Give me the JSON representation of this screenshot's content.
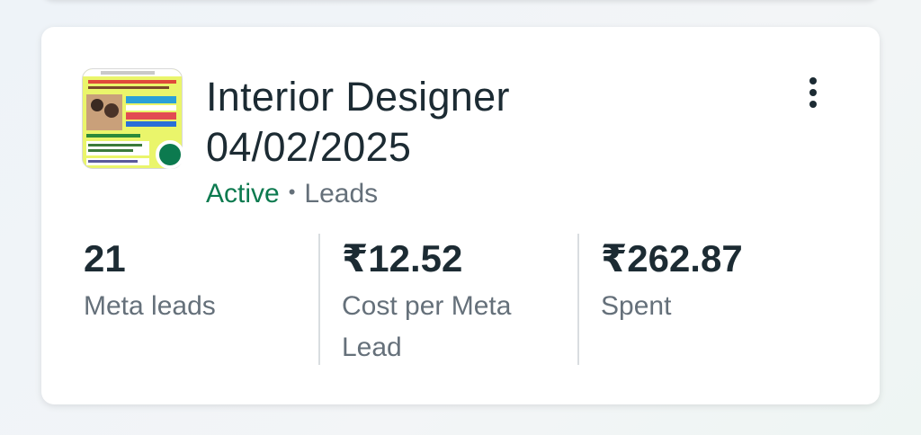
{
  "campaign": {
    "title_line1": "Interior Designer",
    "title_line2": "04/02/2025",
    "status": "Active",
    "separator": "•",
    "objective": "Leads",
    "status_color": "#0c7a4f"
  },
  "metrics": [
    {
      "value": "21",
      "label": "Meta leads"
    },
    {
      "value": "₹12.52",
      "label": "Cost per Meta Lead"
    },
    {
      "value": "₹262.87",
      "label": "Spent"
    }
  ],
  "icons": {
    "more": "more-vertical-icon",
    "status_dot": "status-dot-icon"
  }
}
